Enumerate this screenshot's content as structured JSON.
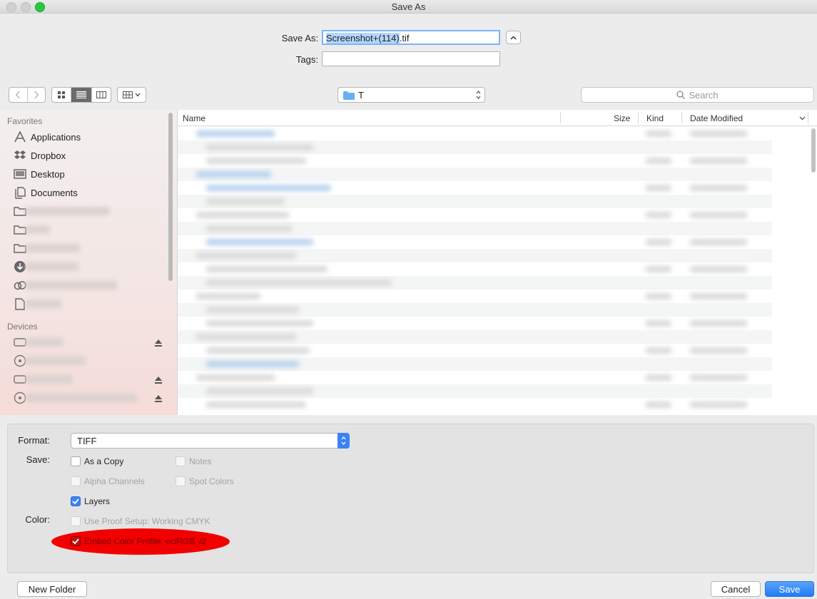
{
  "window": {
    "title": "Save As"
  },
  "save_as": {
    "label": "Save As:",
    "name_selected": "Screenshot+(114)",
    "name_ext": ".tif"
  },
  "tags": {
    "label": "Tags:",
    "value": ""
  },
  "toolbar": {
    "path_folder": "T",
    "search_placeholder": "Search",
    "view_mode_selected": "list"
  },
  "sidebar": {
    "favorites_heading": "Favorites",
    "favorites": [
      {
        "label": "Applications",
        "icon": "applications-icon"
      },
      {
        "label": "Dropbox",
        "icon": "dropbox-icon"
      },
      {
        "label": "Desktop",
        "icon": "desktop-icon"
      },
      {
        "label": "Documents",
        "icon": "documents-icon"
      }
    ],
    "devices_heading": "Devices"
  },
  "file_list": {
    "columns": [
      "Name",
      "Size",
      "Kind",
      "Date Modified"
    ]
  },
  "options": {
    "format_label": "Format:",
    "format_value": "TIFF",
    "save_label": "Save:",
    "color_label": "Color:",
    "as_a_copy": {
      "label": "As a Copy",
      "checked": false
    },
    "notes": {
      "label": "Notes",
      "checked": false,
      "enabled": false
    },
    "alpha_channels": {
      "label": "Alpha Channels",
      "checked": false,
      "enabled": false
    },
    "spot_colors": {
      "label": "Spot Colors",
      "checked": false,
      "enabled": false
    },
    "layers": {
      "label": "Layers",
      "checked": true
    },
    "use_proof_setup": {
      "label": "Use Proof Setup:  Working CMYK",
      "checked": false,
      "enabled": false
    },
    "embed_color_profile": {
      "label": "Embed Color Profile:  eciRGB v2",
      "checked": true
    }
  },
  "buttons": {
    "new_folder": "New Folder",
    "cancel": "Cancel",
    "save": "Save"
  },
  "colors": {
    "accent": "#3b82f6",
    "highlight_oval": "#f20000"
  }
}
